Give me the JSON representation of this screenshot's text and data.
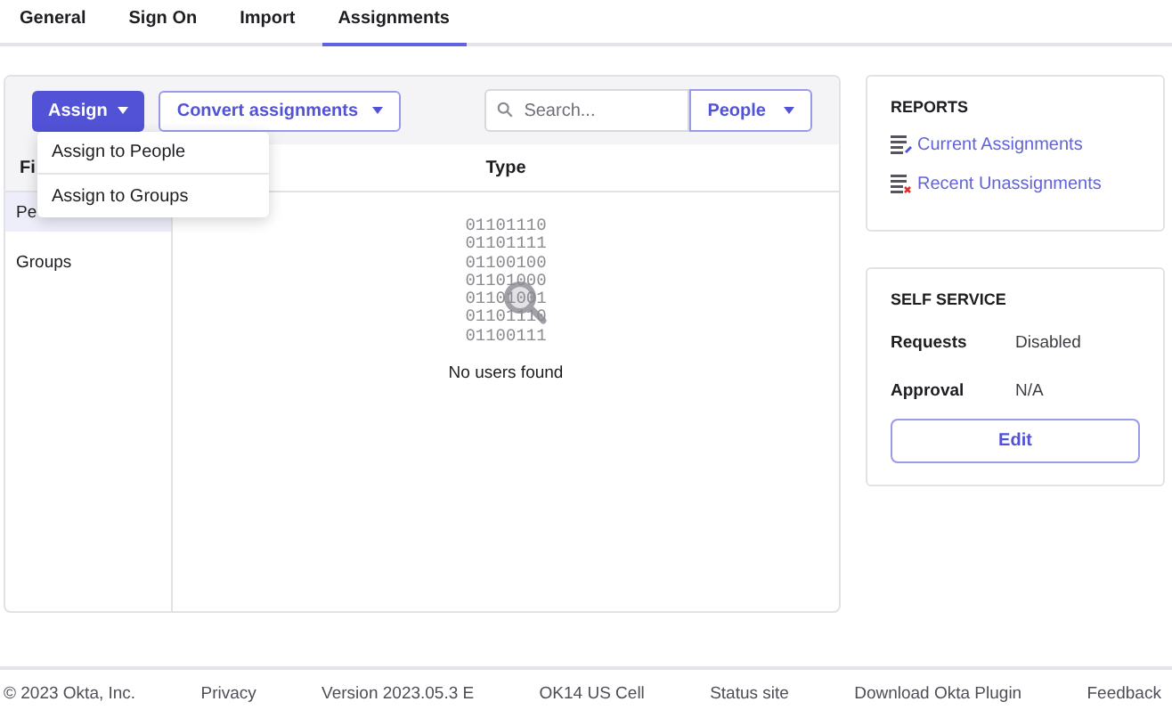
{
  "tabs": [
    {
      "label": "General",
      "selected": false
    },
    {
      "label": "Sign On",
      "selected": false
    },
    {
      "label": "Import",
      "selected": false
    },
    {
      "label": "Assignments",
      "selected": true
    }
  ],
  "toolbar": {
    "assign_button": "Assign",
    "convert_button": "Convert assignments",
    "search": {
      "placeholder": "Search..."
    },
    "filter_select": "People"
  },
  "assign_menu": {
    "items": [
      "Assign to People",
      "Assign to Groups"
    ]
  },
  "filters": {
    "heading": "Fi",
    "items": [
      {
        "label": "Pe",
        "selected": true
      },
      {
        "label": "Groups",
        "selected": false
      }
    ]
  },
  "table": {
    "columns": [
      "Type"
    ],
    "empty_state": {
      "binary": [
        "01101110",
        "01101111",
        "01100100",
        "01101000",
        "01101001",
        "01101110",
        "01100111"
      ],
      "message": "No users found"
    }
  },
  "reports": {
    "title": "REPORTS",
    "links": [
      {
        "label": "Current Assignments",
        "kind": "current"
      },
      {
        "label": "Recent Unassignments",
        "kind": "removed"
      }
    ]
  },
  "self_service": {
    "title": "SELF SERVICE",
    "rows": [
      {
        "label": "Requests",
        "value": "Disabled"
      },
      {
        "label": "Approval",
        "value": "N/A"
      }
    ],
    "button": "Edit"
  },
  "footer": [
    "© 2023 Okta, Inc.",
    "Privacy",
    "Version 2023.05.3 E",
    "OK14 US Cell",
    "Status site",
    "Download Okta Plugin",
    "Feedback"
  ]
}
